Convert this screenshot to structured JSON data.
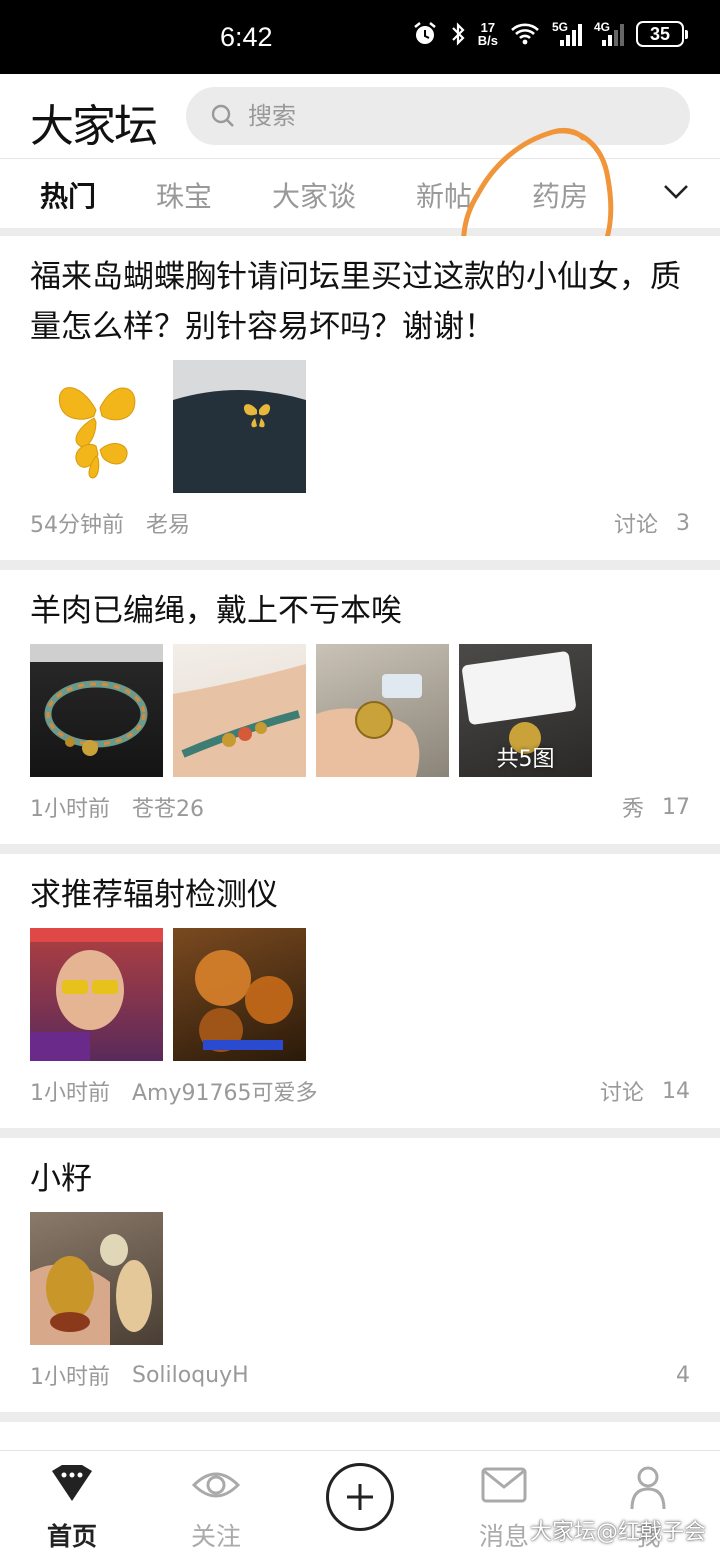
{
  "status_bar": {
    "time": "6:42",
    "net_speed_value": "17",
    "net_speed_unit": "B/s",
    "signal1_label": "5G",
    "signal2_label": "4G",
    "battery": "35"
  },
  "header": {
    "logo": "大家坛",
    "search_placeholder": "搜索"
  },
  "tabs": [
    {
      "label": "热门",
      "active": true
    },
    {
      "label": "珠宝",
      "active": false
    },
    {
      "label": "大家谈",
      "active": false
    },
    {
      "label": "新帖",
      "active": false
    },
    {
      "label": "药房",
      "active": false
    }
  ],
  "posts": [
    {
      "title": "福来岛蝴蝶胸针请问坛里买过这款的小仙女，质量怎么样？别针容易坏吗？谢谢！",
      "time": "54分钟前",
      "author": "老易",
      "tag": "讨论",
      "count": "3"
    },
    {
      "title": "羊肉已编绳，戴上不亏本唉",
      "time": "1小时前",
      "author": "苍苍26",
      "tag": "秀",
      "count": "17",
      "image_count_label": "共5图"
    },
    {
      "title": "求推荐辐射检测仪",
      "time": "1小时前",
      "author": "Amy91765可爱多",
      "tag": "讨论",
      "count": "14"
    },
    {
      "title": "小籽",
      "time": "1小时前",
      "author": "SoliloquyH",
      "tag": "",
      "count": "4"
    }
  ],
  "bottom_nav": [
    {
      "label": "首页",
      "icon": "home-diamond-icon",
      "active": true
    },
    {
      "label": "关注",
      "icon": "eye-icon",
      "active": false
    },
    {
      "label": "消息",
      "icon": "mail-icon",
      "active": false
    },
    {
      "label": "我",
      "icon": "person-icon",
      "active": false
    }
  ],
  "watermark": "大家坛@红戟子会",
  "colors": {
    "annotation_circle": "#f0953a",
    "tab_active": "#111111",
    "tab_inactive": "#999999"
  }
}
